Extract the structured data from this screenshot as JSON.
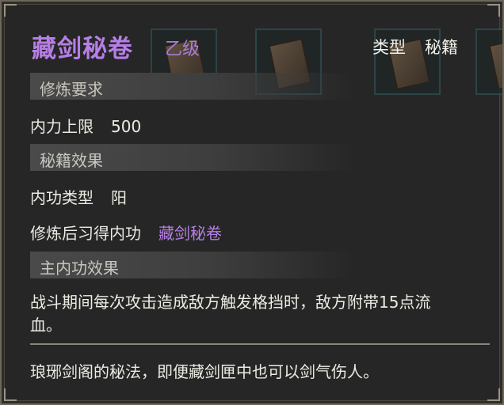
{
  "item": {
    "name": "藏剑秘卷",
    "grade": "乙级",
    "type_label": "类型",
    "type_value": "秘籍"
  },
  "sections": {
    "requirement_title": "修炼要求",
    "requirement_label": "内力上限",
    "requirement_value": "500",
    "effect_title": "秘籍效果",
    "internal_type_label": "内功类型",
    "internal_type_value": "阳",
    "learned_label": "修炼后习得内功",
    "learned_value": "藏剑秘卷",
    "main_effect_title": "主内功效果",
    "main_effect_text": "战斗期间每次攻击造成敌方触发格挡时，敌方附带15点流血。"
  },
  "flavor_text": "琅琊剑阁的秘法，即便藏剑匣中也可以剑气伤人。",
  "colors": {
    "accent_purple": "#b77ee6",
    "background": "#262626",
    "section_bar": "#4a4a4a",
    "text": "#ecebe3"
  }
}
